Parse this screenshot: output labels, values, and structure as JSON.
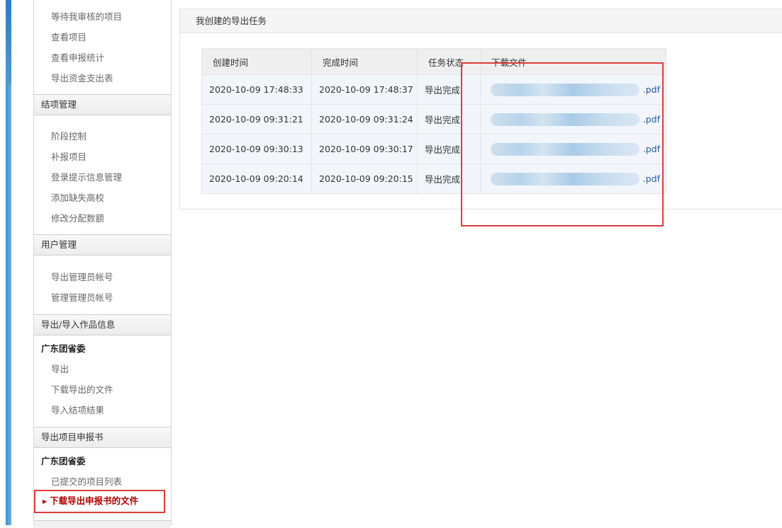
{
  "sidebar": {
    "top_links": [
      "等待我审核的项目",
      "查看项目",
      "查看申报统计",
      "导出资金支出表"
    ],
    "sections": [
      {
        "title": "结项管理",
        "subtitle": "",
        "items": [
          "阶段控制",
          "补报项目",
          "登录提示信息管理",
          "添加缺失高校",
          "修改分配数额"
        ]
      },
      {
        "title": "用户管理",
        "subtitle": "",
        "items": [
          "导出管理员帐号",
          "管理管理员帐号"
        ]
      },
      {
        "title": "导出/导入作品信息",
        "subtitle": "广东团省委",
        "items": [
          "导出",
          "下载导出的文件",
          "导入结项结果"
        ]
      },
      {
        "title": "导出项目申报书",
        "subtitle": "广东团省委",
        "items": [
          "已提交的项目列表"
        ]
      }
    ],
    "active_item": "下载导出申报书的文件"
  },
  "panel": {
    "title": "我创建的导出任务"
  },
  "table": {
    "headers": [
      "创建时间",
      "完成时间",
      "任务状态",
      "下载文件"
    ],
    "rows": [
      {
        "created": "2020-10-09 17:48:33",
        "finished": "2020-10-09 17:48:37",
        "status": "导出完成",
        "file": ".pdf"
      },
      {
        "created": "2020-10-09 09:31:21",
        "finished": "2020-10-09 09:31:24",
        "status": "导出完成",
        "file": ".pdf"
      },
      {
        "created": "2020-10-09 09:30:13",
        "finished": "2020-10-09 09:30:17",
        "status": "导出完成",
        "file": ".pdf"
      },
      {
        "created": "2020-10-09 09:20:14",
        "finished": "2020-10-09 09:20:15",
        "status": "导出完成",
        "file": ".pdf"
      }
    ]
  },
  "colors": {
    "highlight": "#e03a3a",
    "link": "#1f5fa8",
    "accent_strip": "#3b8fd0"
  }
}
